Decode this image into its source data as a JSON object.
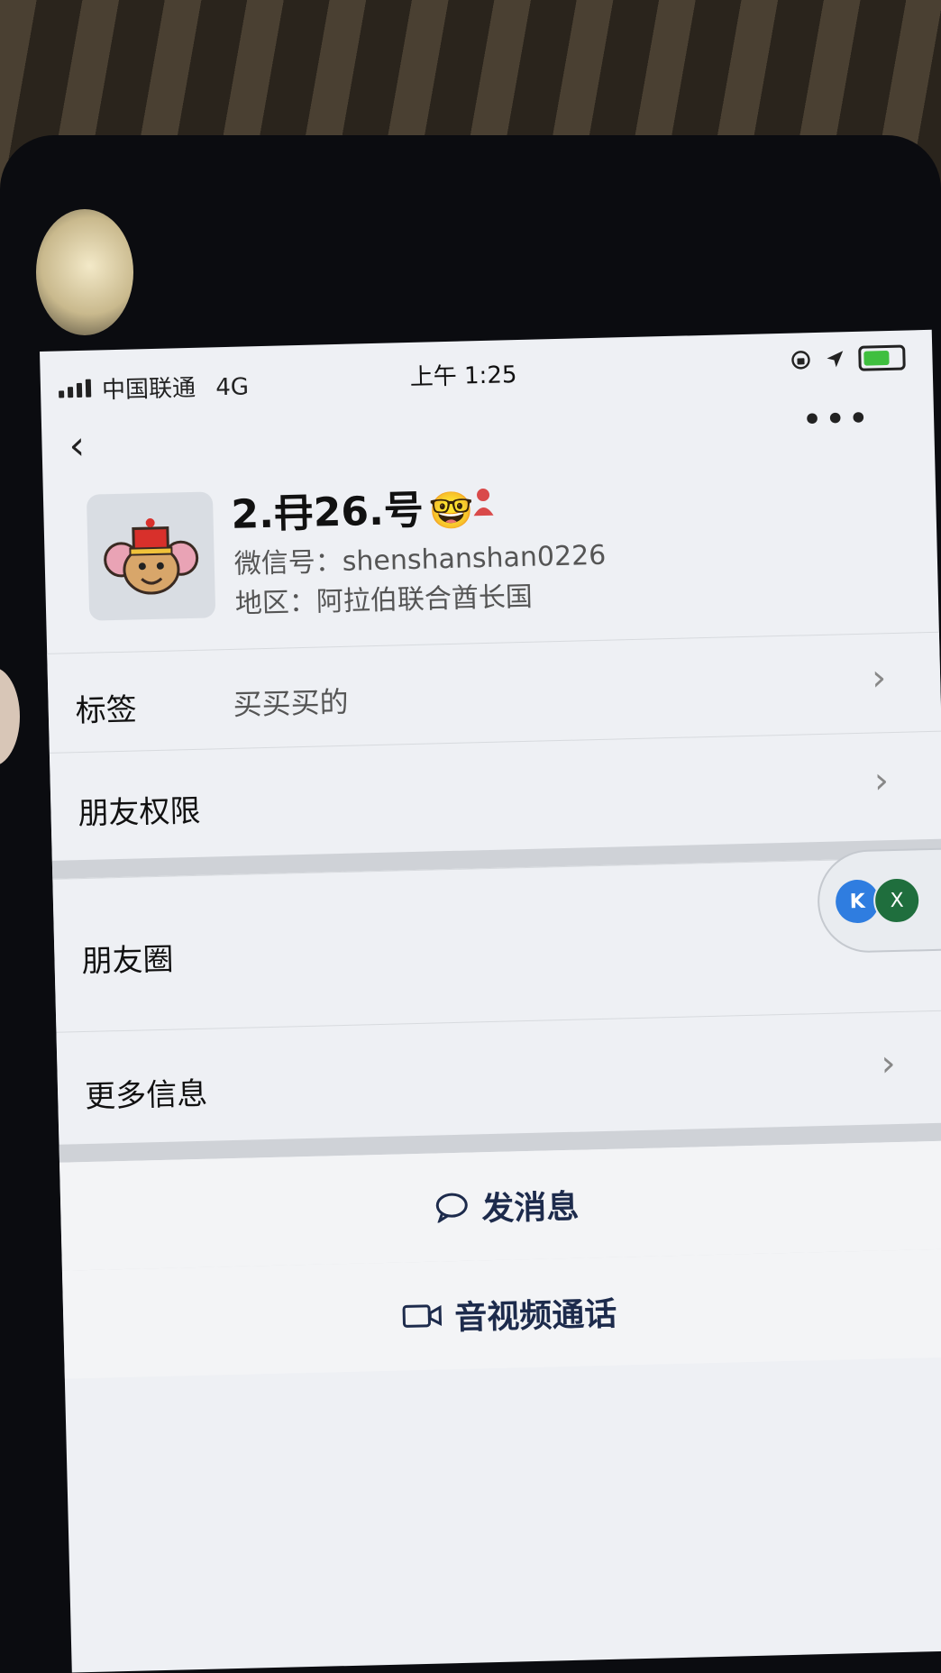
{
  "status_bar": {
    "carrier": "中国联通",
    "network": "4G",
    "time": "上午 1:25"
  },
  "profile": {
    "name": "2.冄26.号",
    "name_emoji": "🤓",
    "wechat_id": "微信号：shenshanshan0226",
    "region": "地区：阿拉伯联合酋长国"
  },
  "rows": {
    "tags_label": "标签",
    "tags_value": "买买买的",
    "permissions_label": "朋友权限",
    "moments_label": "朋友圈",
    "more_info_label": "更多信息"
  },
  "actions": {
    "message_label": "发消息",
    "call_label": "音视频通话"
  },
  "floating": {
    "close_label": "X"
  },
  "colors": {
    "accent": "#1d2b4c",
    "battery": "#3fbf3f"
  }
}
